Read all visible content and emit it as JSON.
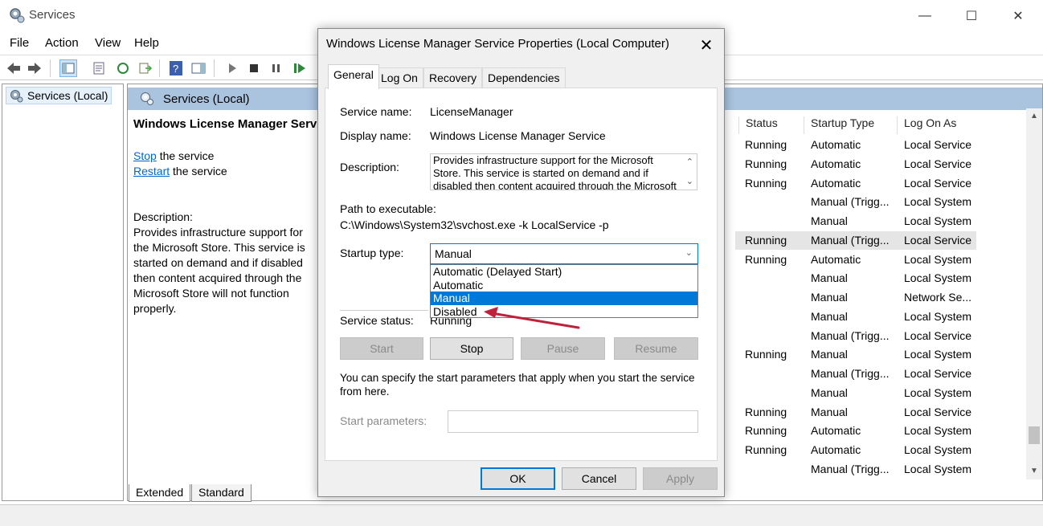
{
  "window": {
    "title": "Services"
  },
  "menu": [
    "File",
    "Action",
    "View",
    "Help"
  ],
  "tree": {
    "item": "Services (Local)"
  },
  "main": {
    "header": "Services (Local)",
    "service_title": "Windows License Manager Servic",
    "stop_link": "Stop",
    "stop_suffix": " the service",
    "restart_link": "Restart",
    "restart_suffix": " the service",
    "description_label": "Description:",
    "description_lines": [
      "Provides infrastructure support for",
      "the Microsoft Store.  This service is",
      "started on demand and if disabled",
      "then content acquired through the",
      "Microsoft Store will not function",
      "properly."
    ]
  },
  "columns": {
    "status": "Status",
    "startup": "Startup Type",
    "logon": "Log On As"
  },
  "rows": [
    {
      "status": "Running",
      "startup": "Automatic",
      "logon": "Local Service"
    },
    {
      "status": "Running",
      "startup": "Automatic",
      "logon": "Local Service"
    },
    {
      "status": "Running",
      "startup": "Automatic",
      "logon": "Local Service"
    },
    {
      "status": "",
      "startup": "Manual (Trigg...",
      "logon": "Local System"
    },
    {
      "status": "",
      "startup": "Manual",
      "logon": "Local System"
    },
    {
      "status": "Running",
      "startup": "Manual (Trigg...",
      "logon": "Local Service"
    },
    {
      "status": "Running",
      "startup": "Automatic",
      "logon": "Local System"
    },
    {
      "status": "",
      "startup": "Manual",
      "logon": "Local System"
    },
    {
      "status": "",
      "startup": "Manual",
      "logon": "Network Se..."
    },
    {
      "status": "",
      "startup": "Manual",
      "logon": "Local System"
    },
    {
      "status": "",
      "startup": "Manual (Trigg...",
      "logon": "Local Service"
    },
    {
      "status": "Running",
      "startup": "Manual",
      "logon": "Local System"
    },
    {
      "status": "",
      "startup": "Manual (Trigg...",
      "logon": "Local Service"
    },
    {
      "status": "",
      "startup": "Manual",
      "logon": "Local System"
    },
    {
      "status": "Running",
      "startup": "Manual",
      "logon": "Local Service"
    },
    {
      "status": "Running",
      "startup": "Automatic",
      "logon": "Local System"
    },
    {
      "status": "Running",
      "startup": "Automatic",
      "logon": "Local System"
    },
    {
      "status": "",
      "startup": "Manual (Trigg...",
      "logon": "Local System"
    }
  ],
  "bottom_tabs": [
    "Extended",
    "Standard"
  ],
  "dialog": {
    "title": "Windows License Manager Service Properties (Local Computer)",
    "tabs": [
      "General",
      "Log On",
      "Recovery",
      "Dependencies"
    ],
    "service_name_label": "Service name:",
    "service_name": "LicenseManager",
    "display_name_label": "Display name:",
    "display_name": "Windows License Manager Service",
    "description_label": "Description:",
    "description_lines": [
      "Provides infrastructure support for the Microsoft",
      "Store.  This service is started on demand and if",
      "disabled then content acquired through the Microsoft"
    ],
    "path_label": "Path to executable:",
    "path": "C:\\Windows\\System32\\svchost.exe -k LocalService -p",
    "startup_label": "Startup type:",
    "startup_value": "Manual",
    "startup_options": [
      "Automatic (Delayed Start)",
      "Automatic",
      "Manual",
      "Disabled"
    ],
    "status_label": "Service status:",
    "status_value": "Running",
    "buttons": {
      "start": "Start",
      "stop": "Stop",
      "pause": "Pause",
      "resume": "Resume"
    },
    "params_note_1": "You can specify the start parameters that apply when you start the service",
    "params_note_2": "from here.",
    "params_label": "Start parameters:",
    "ok": "OK",
    "cancel": "Cancel",
    "apply": "Apply"
  },
  "colors": {
    "accent": "#0078d7",
    "header_bg": "#aac4e0",
    "arrow": "#c0213a"
  }
}
